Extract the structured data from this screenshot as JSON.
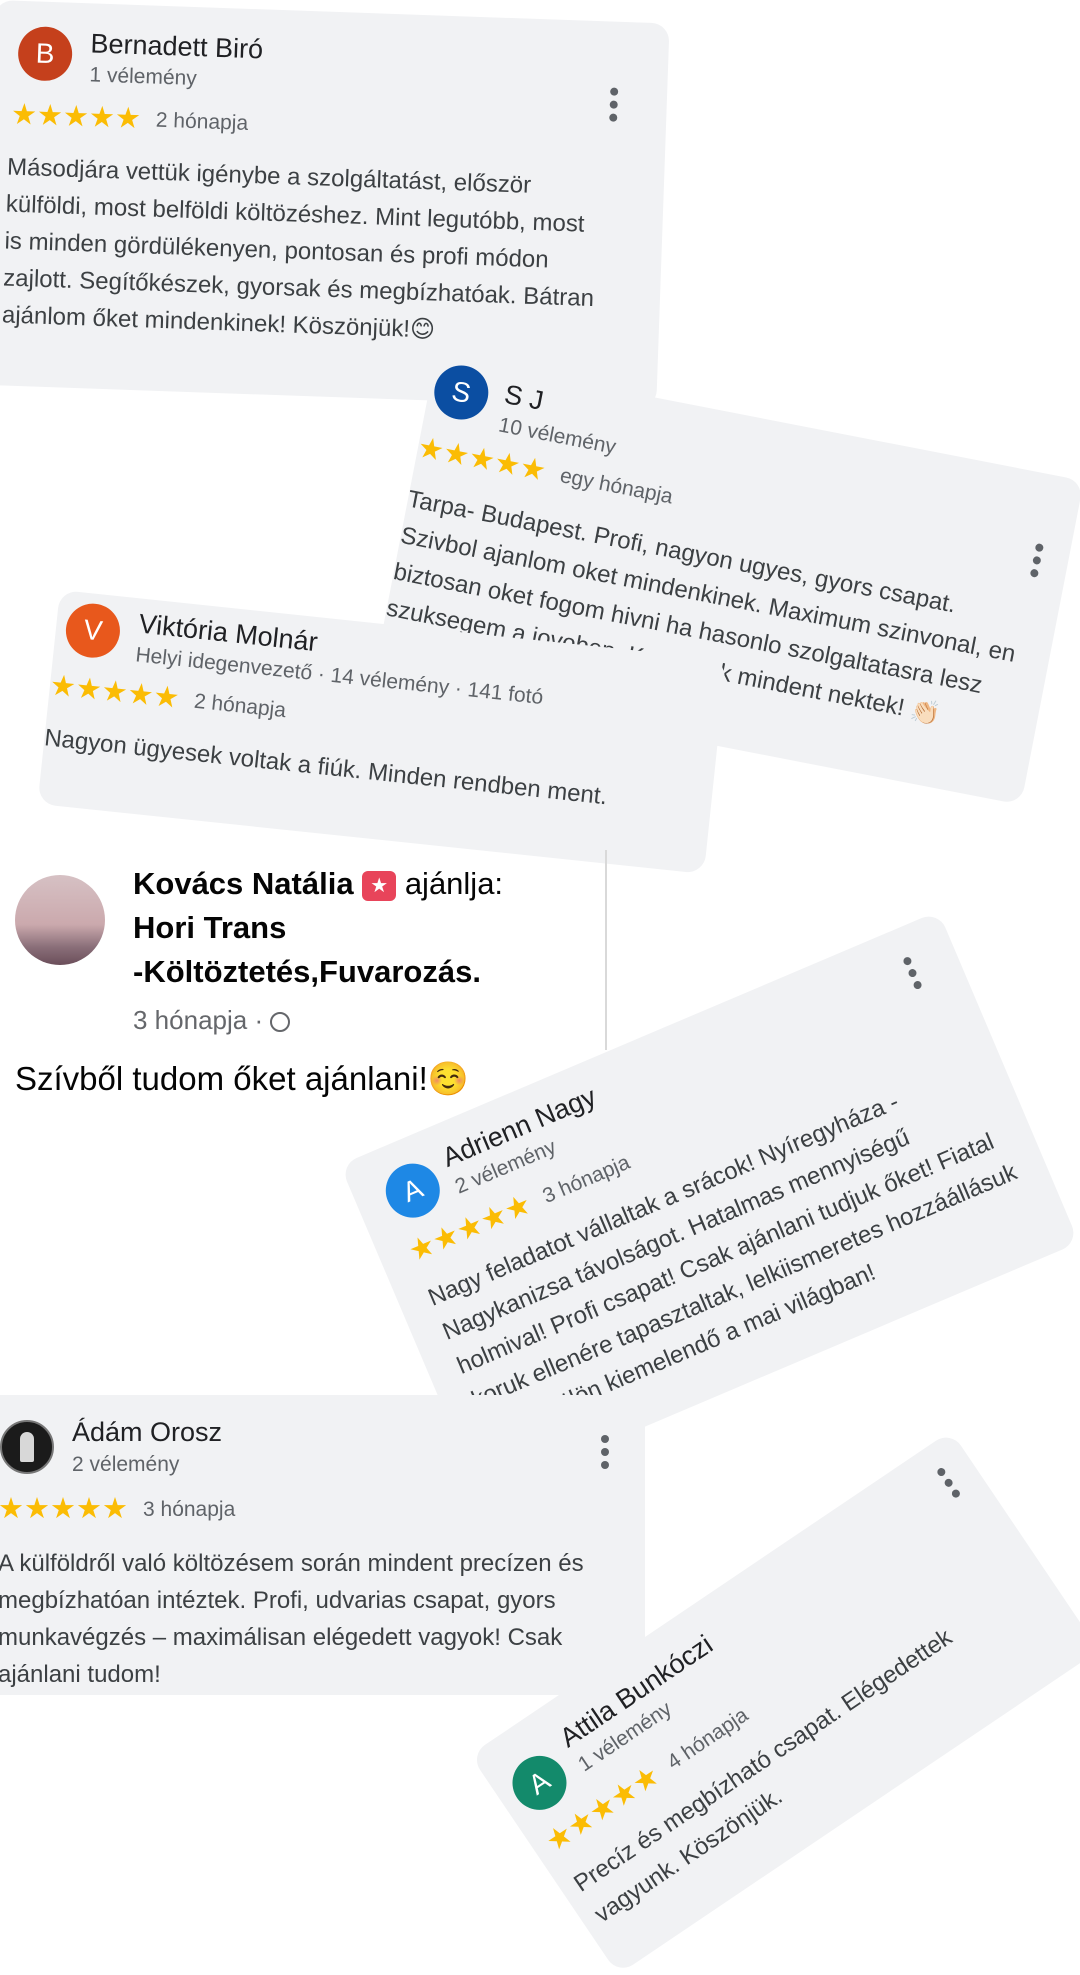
{
  "reviews": [
    {
      "name": "Bernadett Biró",
      "initial": "B",
      "avatar_color": "#c5401c",
      "meta": "1 vélemény",
      "stars": "★★★★★",
      "age": "2 hónapja",
      "text": "Másodjára vettük igénybe a szolgáltatást, először külföldi, most belföldi költözéshez. Mint legutóbb, most is minden gördülékenyen, pontosan és profi módon zajlott. Segítőkészek, gyorsak és megbízhatóak. Bátran ajánlom őket mindenkinek! Köszönjük!😊"
    },
    {
      "name": "S J",
      "initial": "S",
      "avatar_color": "#0b4ea2",
      "meta": "10 vélemény",
      "stars": "★★★★★",
      "age": "egy hónapja",
      "text": "Tarpa- Budapest. Profi, nagyon ugyes, gyors csapat. Szivbol ajanlom oket mindenkinek. Maximum szinvonal, en biztosan oket fogom hivni ha hasonlo szolgaltatasra lesz szuksegem a jovoben. Koszonok mindent nektek! 👏🏻"
    },
    {
      "name": "Viktória Molnár",
      "initial": "V",
      "avatar_color": "#e8581c",
      "meta": "Helyi idegenvezető · 14 vélemény · 141 fotó",
      "stars": "★★★★★",
      "age": "2 hónapja",
      "text": "Nagyon ügyesek voltak a fiúk. Minden rendben ment."
    },
    {
      "name": "Adrienn Nagy",
      "initial": "A",
      "avatar_color": "#1e88e5",
      "meta": "2 vélemény",
      "stars": "★★★★★",
      "age": "3 hónapja",
      "text": "Nagy feladatot vállaltak a srácok! Nyíregyháza - Nagykanizsa távolságot. Hatalmas mennyiségű holmival! Profi csapat! Csak ajánlani tudjuk őket! Fiatal koruk ellenére tapasztaltak, lelkiismeretes hozzáállásuk pedig külön kiemelendő a mai világban!"
    },
    {
      "name": "Ádám Orosz",
      "initial": "",
      "avatar_color": "#1b1b1b",
      "meta": "2 vélemény",
      "stars": "★★★★★",
      "age": "3 hónapja",
      "text": "A külföldről való költözésem során mindent precízen és megbízhatóan intéztek. Profi, udvarias csapat, gyors munkavégzés – maximálisan elégedett vagyok! Csak ajánlani tudom!"
    },
    {
      "name": "Attila Bunkóczi",
      "initial": "A",
      "avatar_color": "#138a6b",
      "meta": "1 vélemény",
      "stars": "★★★★★",
      "age": "4 hónapja",
      "text": "Precíz és megbízható csapat. Elégedettek vagyunk. Köszönjük."
    }
  ],
  "facebook": {
    "name": "Kovács Natália",
    "recommends": "ajánlja:",
    "page_line1": "Hori Trans",
    "page_line2": "-Költöztetés,Fuvarozás.",
    "time": "3 hónapja",
    "separator": "·",
    "text": "Szívből tudom őket ajánlani!☺️"
  },
  "colors": {
    "star": "#fbbc04",
    "card_bg": "#f1f2f4",
    "recommend_badge": "#e8445a"
  }
}
